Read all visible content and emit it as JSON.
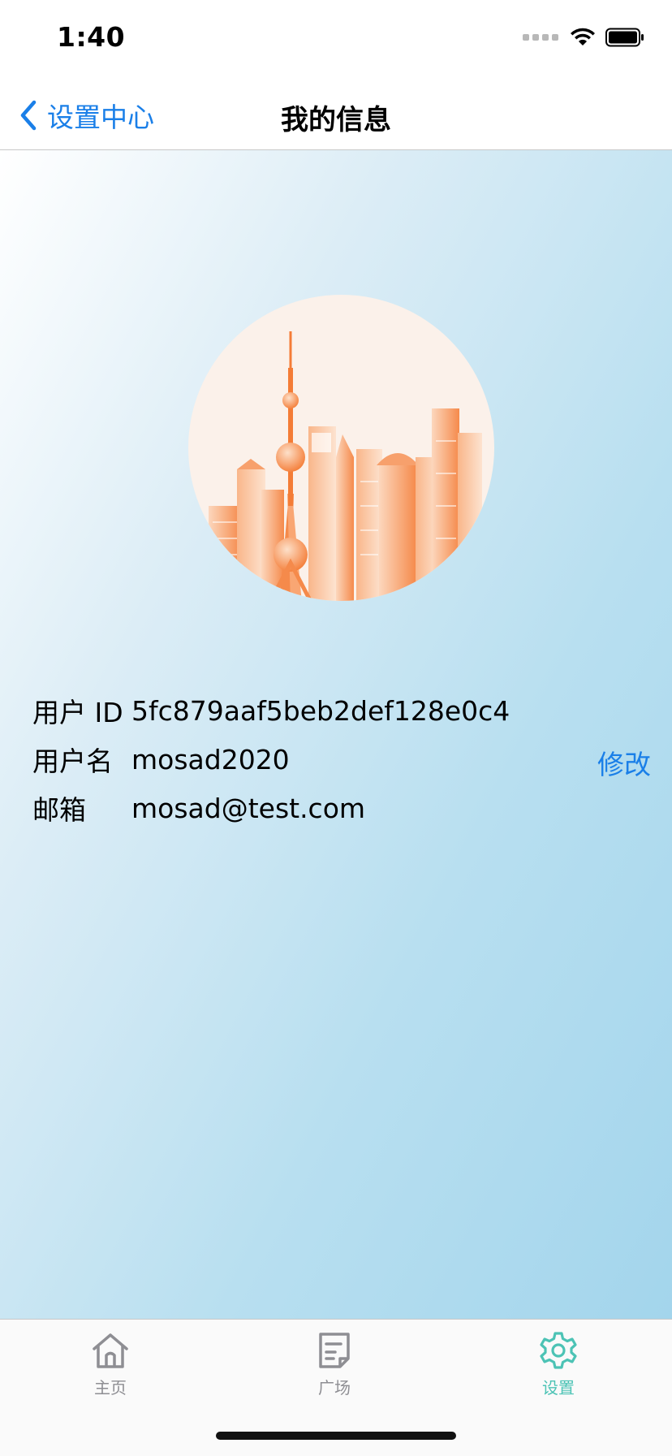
{
  "status_bar": {
    "time": "1:40"
  },
  "nav": {
    "back_label": "设置中心",
    "title": "我的信息"
  },
  "profile": {
    "rows": [
      {
        "label": "用户 ID",
        "value": "5fc879aaf5beb2def128e0c4"
      },
      {
        "label": "用户名",
        "value": "mosad2020"
      },
      {
        "label": "邮箱",
        "value": "mosad@test.com"
      }
    ],
    "edit_label": "修改"
  },
  "tabs": [
    {
      "label": "主页",
      "icon": "home-icon",
      "active": false
    },
    {
      "label": "广场",
      "icon": "document-icon",
      "active": false
    },
    {
      "label": "设置",
      "icon": "gear-icon",
      "active": true
    }
  ],
  "colors": {
    "accent": "#1a7fe8",
    "tab_active": "#4cc3b5",
    "tab_inactive": "#8e8e93",
    "avatar_bg": "#fbf1ea",
    "skyline": "#f58a4b"
  }
}
